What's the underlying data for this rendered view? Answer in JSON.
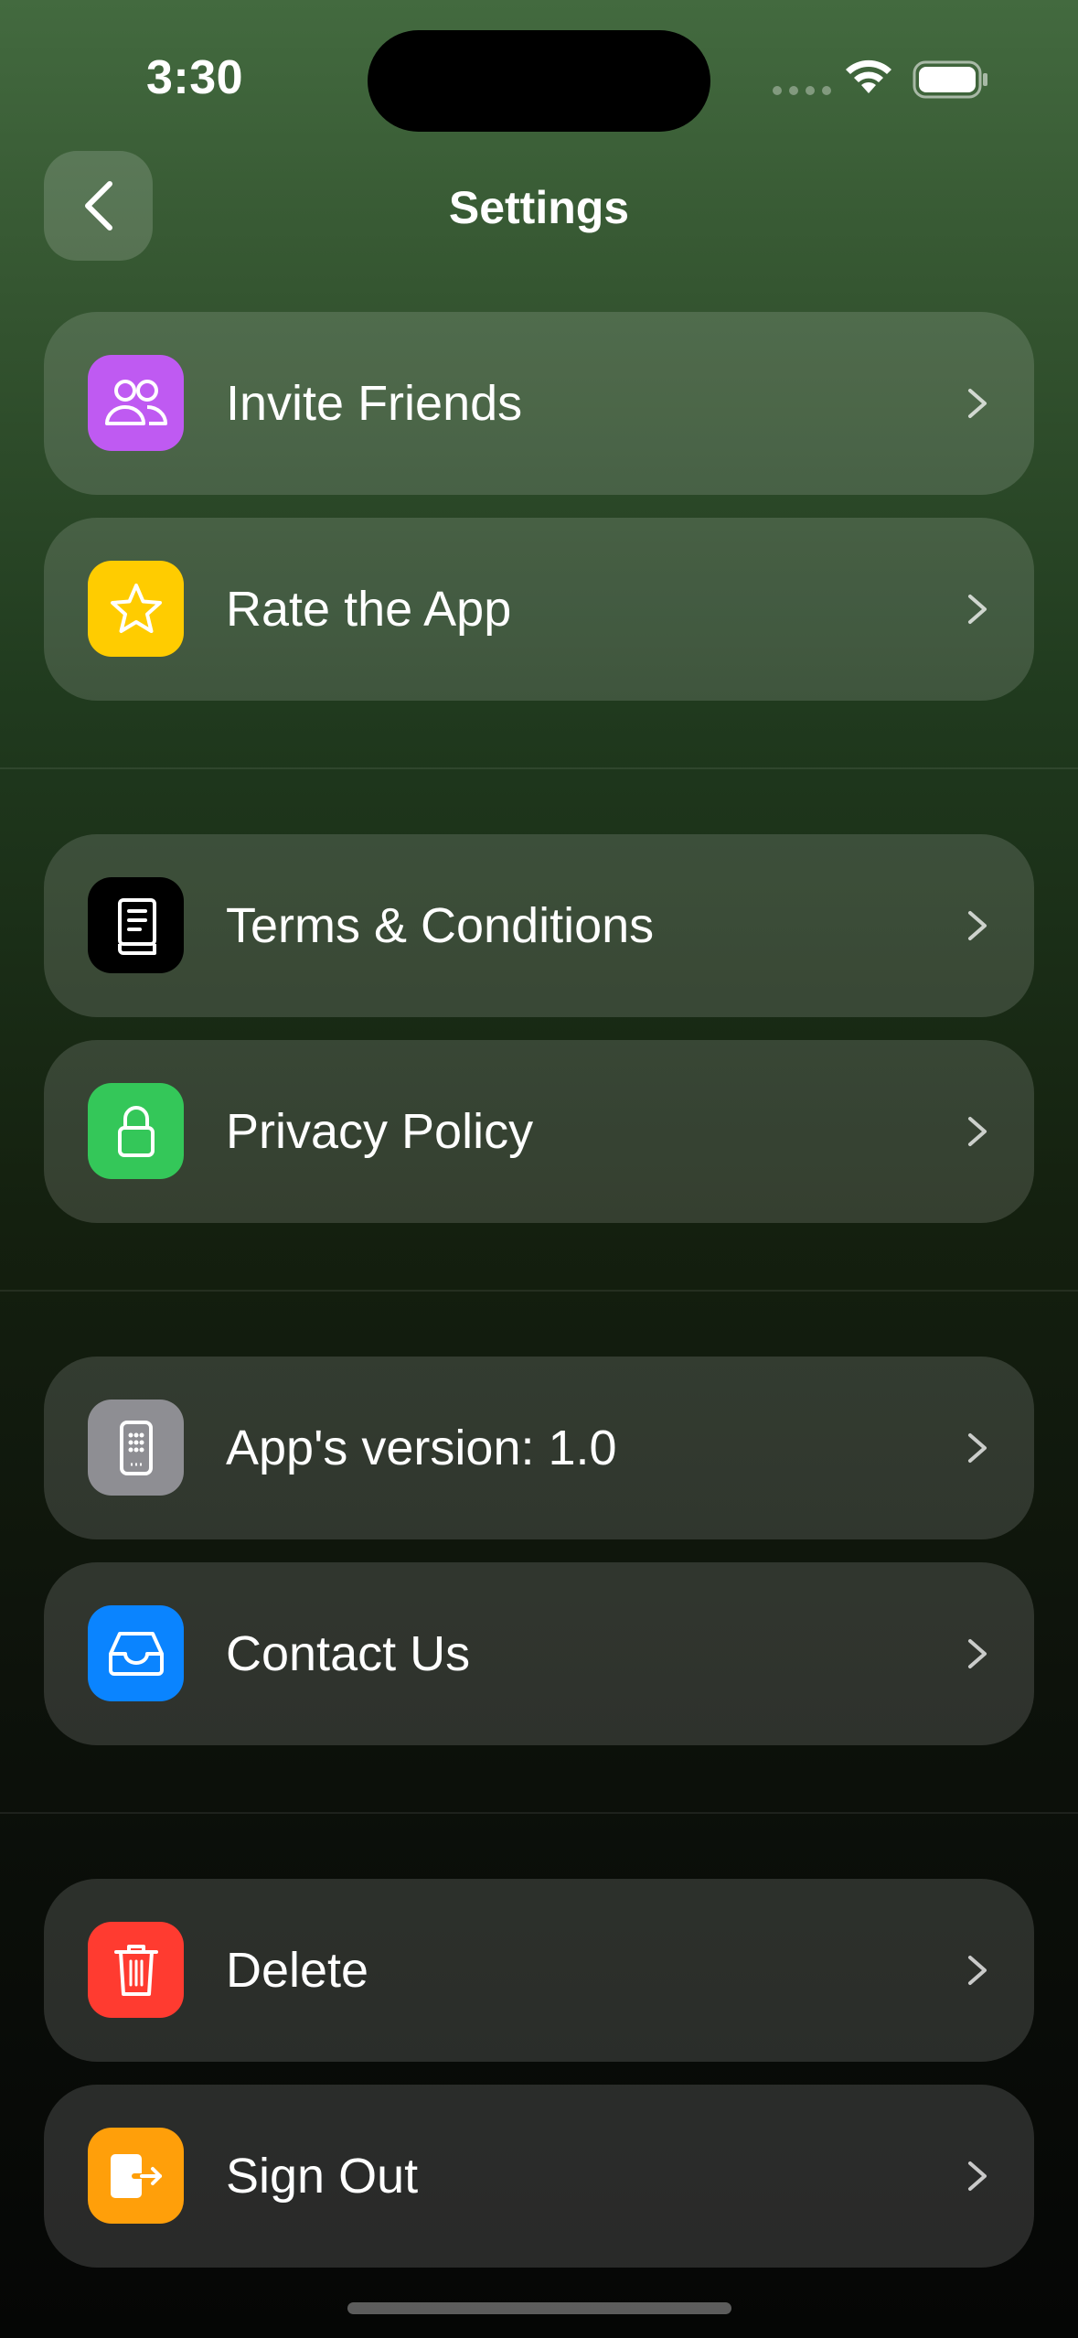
{
  "status_bar": {
    "time": "3:30"
  },
  "header": {
    "title": "Settings"
  },
  "sections": [
    {
      "items": [
        {
          "label": "Invite Friends",
          "icon": "people-icon",
          "icon_bg": "#bf5af2"
        },
        {
          "label": "Rate the App",
          "icon": "star-icon",
          "icon_bg": "#ffcc00"
        }
      ]
    },
    {
      "items": [
        {
          "label": "Terms & Conditions",
          "icon": "book-icon",
          "icon_bg": "#000000"
        },
        {
          "label": "Privacy Policy",
          "icon": "lock-icon",
          "icon_bg": "#34c759"
        }
      ]
    },
    {
      "items": [
        {
          "label": "App's version: 1.0",
          "icon": "phone-icon",
          "icon_bg": "#8e8e93"
        },
        {
          "label": "Contact Us",
          "icon": "tray-icon",
          "icon_bg": "#0a84ff"
        }
      ]
    },
    {
      "items": [
        {
          "label": "Delete",
          "icon": "trash-icon",
          "icon_bg": "#ff3b30"
        },
        {
          "label": "Sign Out",
          "icon": "sign-out-icon",
          "icon_bg": "#ff9f0a"
        }
      ]
    }
  ]
}
